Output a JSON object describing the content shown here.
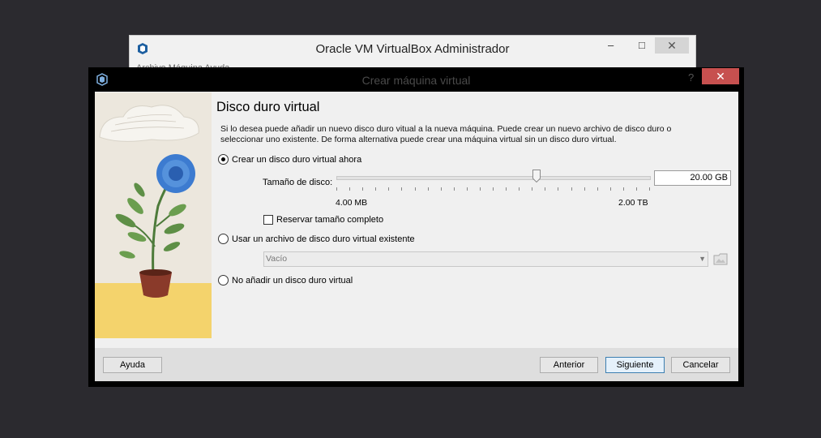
{
  "background_window": {
    "title": "Oracle VM VirtualBox Administrador",
    "minimize": "–",
    "maximize": "□",
    "close": "✕",
    "menu_partial": "Archivo   Máquina   Ayuda"
  },
  "dialog": {
    "title": "Crear máquina virtual",
    "help_glyph": "?",
    "close_glyph": "✕",
    "heading": "Disco duro virtual",
    "description": "Si lo desea puede añadir un nuevo disco duro vitual a la nueva máquina. Puede crear un nuevo archivo de disco duro o seleccionar uno existente. De forma alternativa puede crear una máquina virtual sin un disco duro virtual.",
    "options": {
      "create_now": "Crear un disco duro virtual ahora",
      "use_existing": "Usar un archivo de disco duro virtual existente",
      "no_disk": "No añadir un disco duro virtual"
    },
    "selected_option": "create_now",
    "disk_size_label": "Tamaño de disco:",
    "disk_size_value": "20.00 GB",
    "slider_min": "4.00 MB",
    "slider_max": "2.00 TB",
    "slider_level": 0.64,
    "reserve_full_size": "Reservar tamaño completo",
    "reserve_checked": false,
    "existing_file_combo": "Vacío",
    "buttons": {
      "help": "Ayuda",
      "back": "Anterior",
      "next": "Siguiente",
      "cancel": "Cancelar"
    }
  },
  "colors": {
    "desktop": "#2b2a2f",
    "dialog_frame": "#000000",
    "close_red": "#c7504f",
    "primary_button_border": "#3c7fb1"
  },
  "icons": [
    "virtualbox-icon",
    "folder-browse-icon",
    "chevron-down-icon"
  ]
}
